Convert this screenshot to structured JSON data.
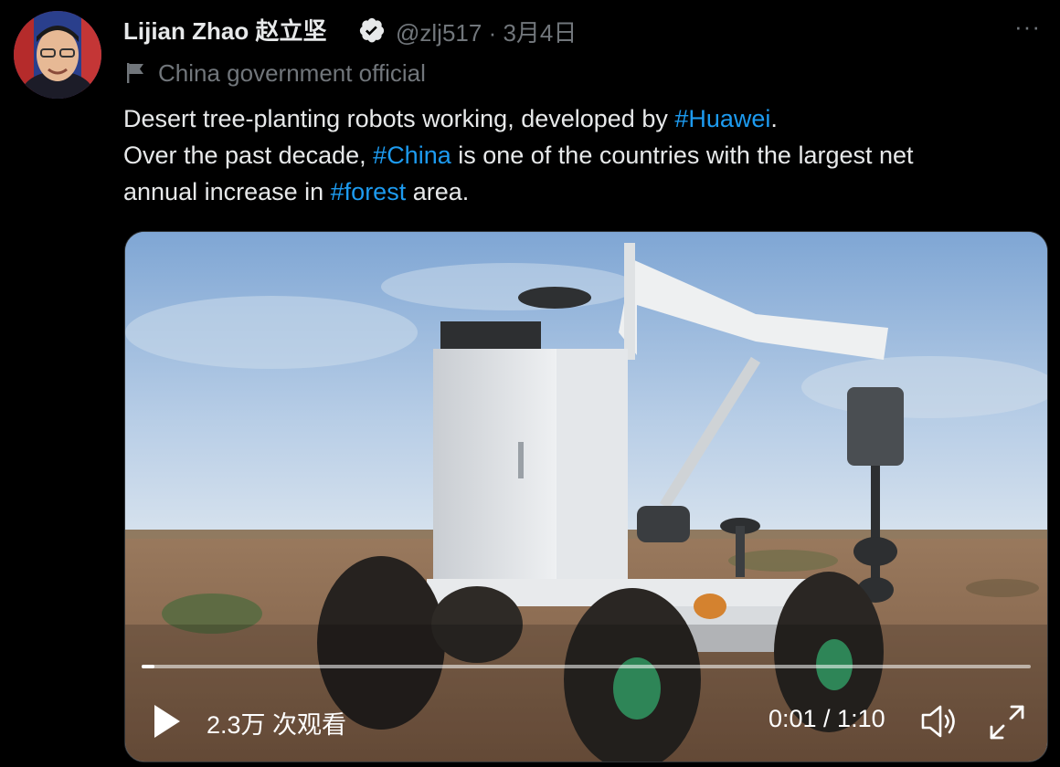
{
  "author": {
    "display_name": "Lijian Zhao 赵立坚",
    "handle": "@zlj517",
    "separator": "·",
    "date": "3月4日",
    "verified": true,
    "label": "China government official",
    "avatar_icon": "profile-photo"
  },
  "more_label": "···",
  "tweet": {
    "line1_pre": "Desert tree-planting robots working, developed by ",
    "line1_tag": "#Huawei",
    "line1_post": ".",
    "line2_pre": "Over the past decade, ",
    "line2_tag": "#China",
    "line2_post": " is one of the countries with the largest net",
    "line3_pre": "annual increase in ",
    "line3_tag": "#forest",
    "line3_post": " area."
  },
  "video": {
    "views": "2.3万 次观看",
    "time": "0:01 / 1:10",
    "progress_fraction": 0.014,
    "icons": {
      "play": "play-icon",
      "volume": "volume-icon",
      "fullscreen": "fullscreen-icon"
    }
  },
  "colors": {
    "background": "#000000",
    "text": "#e7e9ea",
    "muted": "#71767b",
    "link": "#1d9bf0"
  }
}
